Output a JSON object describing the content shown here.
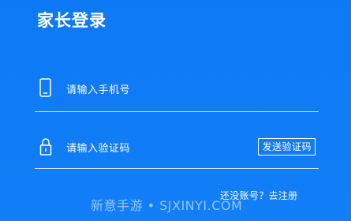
{
  "header": {
    "title": "家长登录"
  },
  "form": {
    "phone": {
      "placeholder": "请输入手机号",
      "icon": "phone-icon"
    },
    "code": {
      "placeholder": "请输入验证码",
      "icon": "lock-icon",
      "send_button_label": "发送验证码"
    }
  },
  "footer": {
    "register_link": "还没账号？去注册"
  },
  "watermark": "新意手游 • SJXINYI.COM",
  "colors": {
    "background": "#0f7cf6",
    "foreground": "#ffffff"
  }
}
